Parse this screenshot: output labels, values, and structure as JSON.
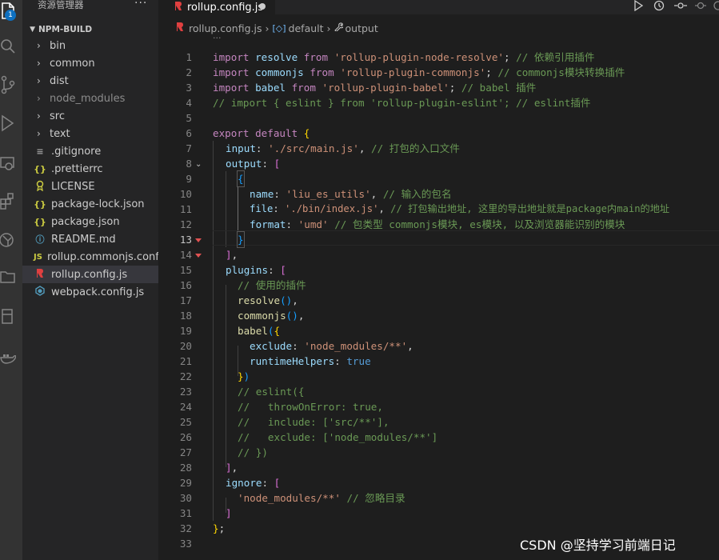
{
  "activity_bar": {
    "badge_count": "1",
    "icons": [
      "explorer-icon",
      "search-icon",
      "source-control-icon",
      "run-debug-icon",
      "remote-explorer-icon",
      "extensions-icon",
      "git-graph-icon",
      "folder-icon",
      "database-icon",
      "docker-icon"
    ]
  },
  "sidebar": {
    "title": "资源管理器",
    "more": "···",
    "folder_name": "NPM-BUILD",
    "items": [
      {
        "label": "bin",
        "type": "folder"
      },
      {
        "label": "common",
        "type": "folder"
      },
      {
        "label": "dist",
        "type": "folder"
      },
      {
        "label": "node_modules",
        "type": "folder",
        "dimmed": true
      },
      {
        "label": "src",
        "type": "folder"
      },
      {
        "label": "text",
        "type": "folder"
      },
      {
        "label": ".gitignore",
        "type": "file",
        "icon": "≡"
      },
      {
        "label": ".prettierrc",
        "type": "file",
        "icon": "{}"
      },
      {
        "label": "LICENSE",
        "type": "file",
        "icon": "license"
      },
      {
        "label": "package-lock.json",
        "type": "file",
        "icon": "{}"
      },
      {
        "label": "package.json",
        "type": "file",
        "icon": "{}"
      },
      {
        "label": "README.md",
        "type": "file",
        "icon": "ⓘ"
      },
      {
        "label": "rollup.commonjs.conf...",
        "type": "file",
        "icon": "JS"
      },
      {
        "label": "rollup.config.js",
        "type": "file",
        "icon": "rollup",
        "active": true
      },
      {
        "label": "webpack.config.js",
        "type": "file",
        "icon": "webpack"
      }
    ]
  },
  "tab": {
    "label": "rollup.config.js"
  },
  "breadcrumb": {
    "file": "rollup.config.js",
    "symbol1": "default",
    "symbol2": "output",
    "ellipsis": "···"
  },
  "colors": {
    "keyword": "#c586c0",
    "string": "#ce9178",
    "comment": "#6a9955",
    "property": "#9cdcfe",
    "function": "#dcdcaa",
    "accent": "#0e70c0"
  },
  "code": {
    "line_numbers": [
      "1",
      "2",
      "3",
      "4",
      "5",
      "6",
      "7",
      "8",
      "9",
      "10",
      "11",
      "12",
      "13",
      "14",
      "15",
      "16",
      "17",
      "18",
      "19",
      "20",
      "21",
      "22",
      "23",
      "24",
      "25",
      "26",
      "27",
      "28",
      "29",
      "30",
      "31",
      "32",
      "33"
    ],
    "current_line": "13",
    "l1": {
      "a": "import",
      "b": " resolve ",
      "c": "from",
      "d": " ",
      "e": "'rollup-plugin-node-resolve'",
      "f": "; ",
      "g": "// 依赖引用插件"
    },
    "l2": {
      "a": "import",
      "b": " commonjs ",
      "c": "from",
      "d": " ",
      "e": "'rollup-plugin-commonjs'",
      "f": "; ",
      "g": "// commonjs模块转换插件"
    },
    "l3": {
      "a": "import",
      "b": " babel ",
      "c": "from",
      "d": " ",
      "e": "'rollup-plugin-babel'",
      "f": "; ",
      "g": "// babel 插件"
    },
    "l4": "// import { eslint } from 'rollup-plugin-eslint'; // eslint插件",
    "l6": {
      "a": "export",
      "b": " ",
      "c": "default",
      "d": " ",
      "e": "{"
    },
    "l7": {
      "a": "input",
      "b": ": ",
      "c": "'./src/main.js'",
      "d": ", ",
      "e": "// 打包的入口文件"
    },
    "l8": {
      "a": "output",
      "b": ": ",
      "c": "["
    },
    "l9": "{",
    "l10": {
      "a": "name",
      "b": ": ",
      "c": "'liu_es_utils'",
      "d": ", ",
      "e": "// 输入的包名"
    },
    "l11": {
      "a": "file",
      "b": ": ",
      "c": "'./bin/index.js'",
      "d": ", ",
      "e": "// 打包输出地址, 这里的导出地址就是package内main的地址"
    },
    "l12": {
      "a": "format",
      "b": ": ",
      "c": "'umd'",
      "d": " ",
      "e": "// 包类型 commonjs模块, es模块, 以及浏览器能识别的模块"
    },
    "l13": "}",
    "l14": {
      "a": "]",
      "b": ","
    },
    "l15": {
      "a": "plugins",
      "b": ": ",
      "c": "["
    },
    "l16": "// 使用的插件",
    "l17": {
      "a": "resolve",
      "b": "()",
      "c": ","
    },
    "l18": {
      "a": "commonjs",
      "b": "()",
      "c": ","
    },
    "l19": {
      "a": "babel",
      "b": "(",
      "c": "{"
    },
    "l20": {
      "a": "exclude",
      "b": ": ",
      "c": "'node_modules/**'",
      "d": ","
    },
    "l21": {
      "a": "runtimeHelpers",
      "b": ": ",
      "c": "true"
    },
    "l22": {
      "a": "}",
      "b": ")"
    },
    "l23": "// eslint({",
    "l24": "//   throwOnError: true,",
    "l25": "//   include: ['src/**'],",
    "l26": "//   exclude: ['node_modules/**']",
    "l27": "// })",
    "l28": {
      "a": "]",
      "b": ","
    },
    "l29": {
      "a": "ignore",
      "b": ": ",
      "c": "["
    },
    "l30": {
      "a": "'node_modules/**'",
      "b": " ",
      "c": "// 忽略目录"
    },
    "l31": "]",
    "l32": {
      "a": "}",
      "b": ";"
    }
  },
  "watermark": "CSDN @坚持学习前端日记"
}
